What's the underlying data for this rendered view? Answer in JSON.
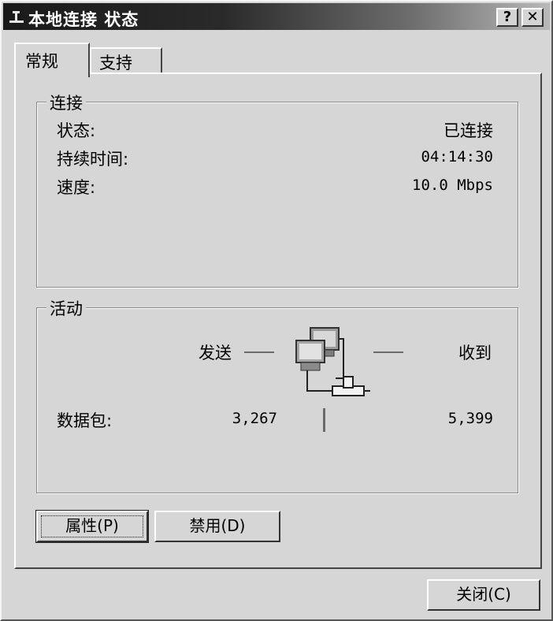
{
  "window": {
    "title": "本地连接 状态",
    "help_button": "?",
    "close_button": "✕"
  },
  "tabs": [
    {
      "label": "常规",
      "selected": true
    },
    {
      "label": "支持",
      "selected": false
    }
  ],
  "connection": {
    "legend": "连接",
    "status_label": "状态:",
    "status_value": "已连接",
    "duration_label": "持续时间:",
    "duration_value": "04:14:30",
    "speed_label": "速度:",
    "speed_value": "10.0 Mbps"
  },
  "activity": {
    "legend": "活动",
    "sent_label": "发送",
    "received_label": "收到",
    "packets_label": "数据包:",
    "packets_sent": "3,267",
    "packets_received": "5,399",
    "icon": "network-computers-icon"
  },
  "buttons": {
    "properties": "属性(P)",
    "disable": "禁用(D)",
    "close": "关闭(C)"
  }
}
